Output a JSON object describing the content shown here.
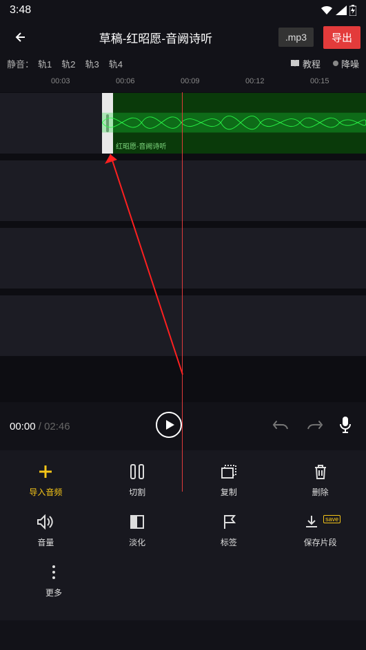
{
  "status": {
    "time": "3:48"
  },
  "header": {
    "title": "草稿-红昭愿-音阙诗听",
    "ext": ".mp3",
    "export": "导出"
  },
  "sub": {
    "mute": "静音：",
    "tracks": [
      "轨1",
      "轨2",
      "轨3",
      "轨4"
    ],
    "tutorial": "教程",
    "noise": "降噪"
  },
  "ruler": [
    "00:03",
    "00:06",
    "00:09",
    "00:12",
    "00:15"
  ],
  "clip": {
    "label": "红昭愿-音阙诗听"
  },
  "transport": {
    "current": "00:00",
    "sep": " / ",
    "total": "02:46"
  },
  "tools": {
    "row1": [
      {
        "label": "导入音频"
      },
      {
        "label": "切割"
      },
      {
        "label": "复制"
      },
      {
        "label": "删除"
      }
    ],
    "row2": [
      {
        "label": "音量"
      },
      {
        "label": "淡化"
      },
      {
        "label": "标签"
      },
      {
        "label": "保存片段",
        "badge": "save"
      }
    ],
    "more": "更多"
  }
}
